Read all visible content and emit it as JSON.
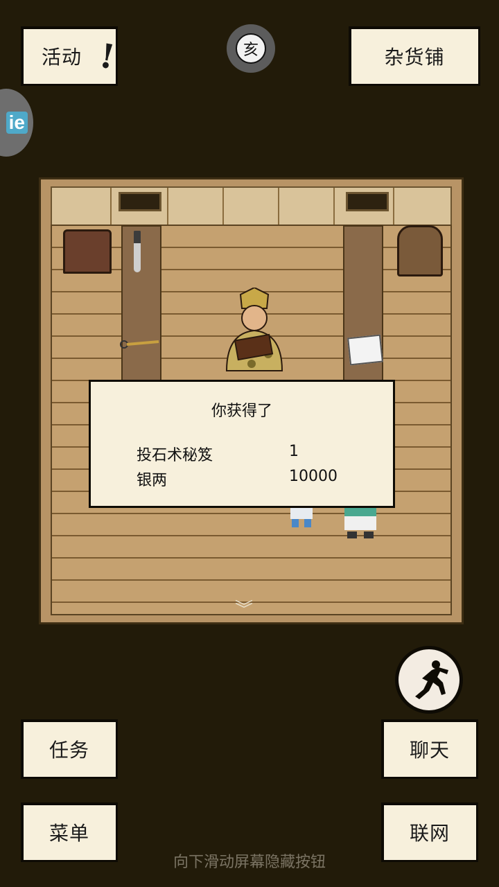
{
  "top": {
    "activity_label": "活动",
    "activity_alert": "!",
    "shop_label": "杂货铺",
    "time_glyph": "亥",
    "side_tab_label": "ie"
  },
  "dialog": {
    "title": "你获得了",
    "rewards": [
      {
        "name": "投石术秘笈",
        "amount": "1"
      },
      {
        "name": "银两",
        "amount": "10000"
      }
    ]
  },
  "bottom": {
    "task_label": "任务",
    "menu_label": "菜单",
    "chat_label": "聊天",
    "network_label": "联网",
    "hint": "向下滑动屏幕隐藏按钮"
  },
  "icons": {
    "run": "running-man-icon",
    "scroll_down": "chevron-down-icon"
  },
  "colors": {
    "background": "#221b09",
    "paper": "#f7f0dc",
    "floor": "#c5a170"
  }
}
